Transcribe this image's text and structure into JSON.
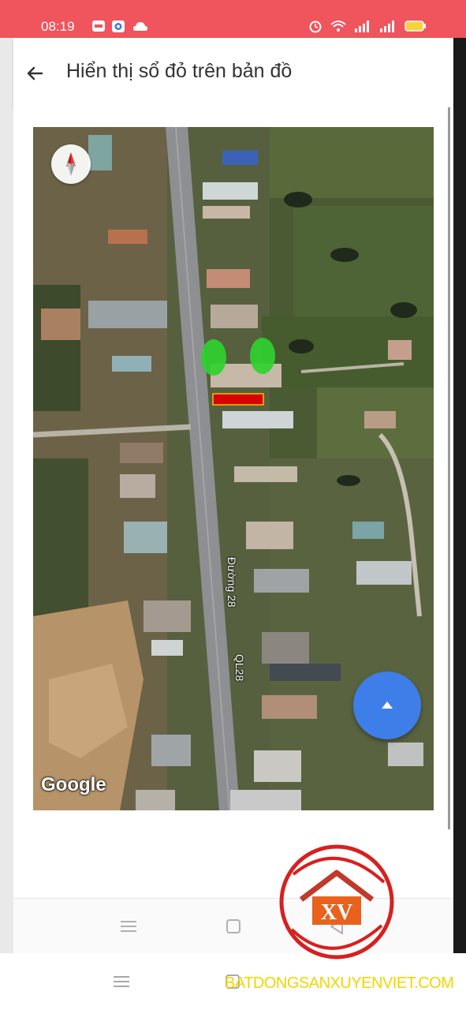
{
  "status_bar": {
    "time": "08:19",
    "background": "#f0545c",
    "left_icons": [
      "zalo-icon",
      "messenger-icon",
      "cloud-icon"
    ],
    "right_icons": [
      "alarm-icon",
      "wifi-icon",
      "signal-icon",
      "signal-icon",
      "battery-icon"
    ]
  },
  "app_bar": {
    "back_icon": "arrow-left-icon",
    "title": "Hiển thị sổ đỏ trên bản đồ"
  },
  "map": {
    "attribution": "Google",
    "road_labels": [
      "Đường 28",
      "QL28"
    ],
    "compass_icon": "compass-icon",
    "fab_icon": "triangle-up-icon",
    "fab_color": "#3e7ee8",
    "markers": [
      "green-marker",
      "green-marker"
    ],
    "parcel_color": "#d80000"
  },
  "navigation": {
    "inner": [
      "menu-icon",
      "home-square-icon",
      "back-triangle-icon"
    ],
    "outer": [
      "menu-icon",
      "home-square-icon"
    ]
  },
  "watermark": {
    "logo_text": "XV",
    "site": "BATDONGSANXUYENVIET.COM",
    "site_color": "#f3d400"
  }
}
